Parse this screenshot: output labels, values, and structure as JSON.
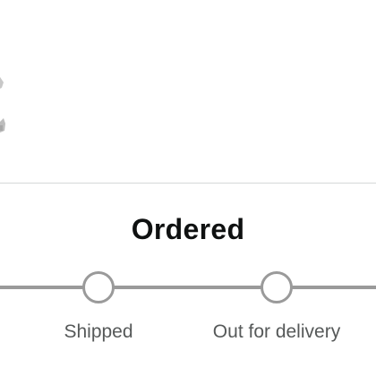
{
  "header": {
    "status_title": "Ordered"
  },
  "product": {
    "image_icon": "product-thumbnail-icon"
  },
  "tracker": {
    "color": "#9a9a9a",
    "steps": [
      {
        "label": "Shipped",
        "state": "pending"
      },
      {
        "label": "Out for delivery",
        "state": "pending"
      }
    ]
  }
}
